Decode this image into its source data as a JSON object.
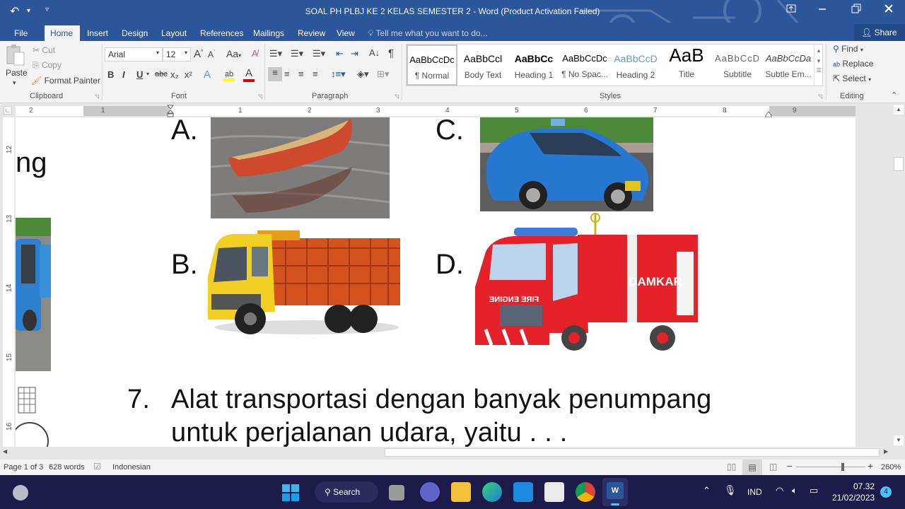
{
  "window": {
    "title": "SOAL PH PLBJ KE 2 KELAS SEMESTER 2 - Word (Product Activation Failed)",
    "controls": [
      "ribbon-display",
      "minimize",
      "restore",
      "close"
    ]
  },
  "quick_access": {
    "undo_icon": "↶",
    "dropdown_icon": "▾",
    "customize_icon": "▿"
  },
  "tabs": [
    {
      "label": "File"
    },
    {
      "label": "Home",
      "active": true
    },
    {
      "label": "Insert"
    },
    {
      "label": "Design"
    },
    {
      "label": "Layout"
    },
    {
      "label": "References"
    },
    {
      "label": "Mailings"
    },
    {
      "label": "Review"
    },
    {
      "label": "View"
    }
  ],
  "tell_me": "Tell me what you want to do...",
  "share_label": "Share",
  "ribbon": {
    "clipboard": {
      "group": "Clipboard",
      "paste": "Paste",
      "cut": "Cut",
      "copy": "Copy",
      "format_painter": "Format Painter"
    },
    "font": {
      "group": "Font",
      "font_name": "Arial",
      "font_size": "12",
      "buttons": [
        "B",
        "I",
        "U",
        "abc",
        "x₂",
        "x²"
      ],
      "change_case": "Aa",
      "highlight_color": "#ffff00",
      "font_color": "#e00000"
    },
    "paragraph": {
      "group": "Paragraph"
    },
    "styles": {
      "group": "Styles",
      "items": [
        {
          "preview": "AaBbCcDc",
          "name": "¶ Normal",
          "selected": true
        },
        {
          "preview": "AaBbCcl",
          "name": "Body Text"
        },
        {
          "preview": "AaBbCc",
          "name": "Heading 1"
        },
        {
          "preview": "AaBbCcDc",
          "name": "¶ No Spac..."
        },
        {
          "preview": "AaBbCcD",
          "name": "Heading 2"
        },
        {
          "preview": "AaB",
          "name": "Title"
        },
        {
          "preview": "AaBbCcD",
          "name": "Subtitle"
        },
        {
          "preview": "AaBbCcDa",
          "name": "Subtle Em..."
        }
      ]
    },
    "editing": {
      "group": "Editing",
      "find": "Find",
      "replace": "Replace",
      "select": "Select"
    }
  },
  "ruler": {
    "horizontal_numbers": [
      "2",
      "1",
      "1",
      "2",
      "3",
      "4",
      "5",
      "6",
      "7",
      "8",
      "9"
    ],
    "vertical_numbers": [
      "12",
      "13",
      "14",
      "15",
      "16"
    ]
  },
  "document": {
    "partial_left_text": "ng",
    "options": [
      {
        "letter": "A.",
        "image": "Red wooden rowboat on water"
      },
      {
        "letter": "B.",
        "image": "Yellow and orange cargo truck"
      },
      {
        "letter": "C.",
        "image": "Blue taxi car"
      },
      {
        "letter": "D.",
        "image": "Red fire engine labelled DAMKAR / FIRE ENGINE"
      }
    ],
    "fire_truck_text": "DAMKAR",
    "fire_truck_front": "FIRE ENGINE",
    "question_number": "7.",
    "question_line1": "Alat transportasi dengan banyak penumpang",
    "question_line2": "untuk perjalanan udara, yaitu . . ."
  },
  "status_bar": {
    "page": "Page 1 of 3",
    "words": "628 words",
    "language": "Indonesian",
    "zoom": "260%",
    "zoom_minus": "−",
    "zoom_plus": "+"
  },
  "taskbar": {
    "search_label": "Search",
    "language": "IND",
    "time": "07.32",
    "date": "21/02/2023",
    "notification_count": "4",
    "pinned": [
      "Start",
      "Search",
      "Task View",
      "Teams",
      "File Explorer",
      "Edge",
      "Mail",
      "Microsoft Store",
      "Chrome",
      "Word"
    ]
  }
}
